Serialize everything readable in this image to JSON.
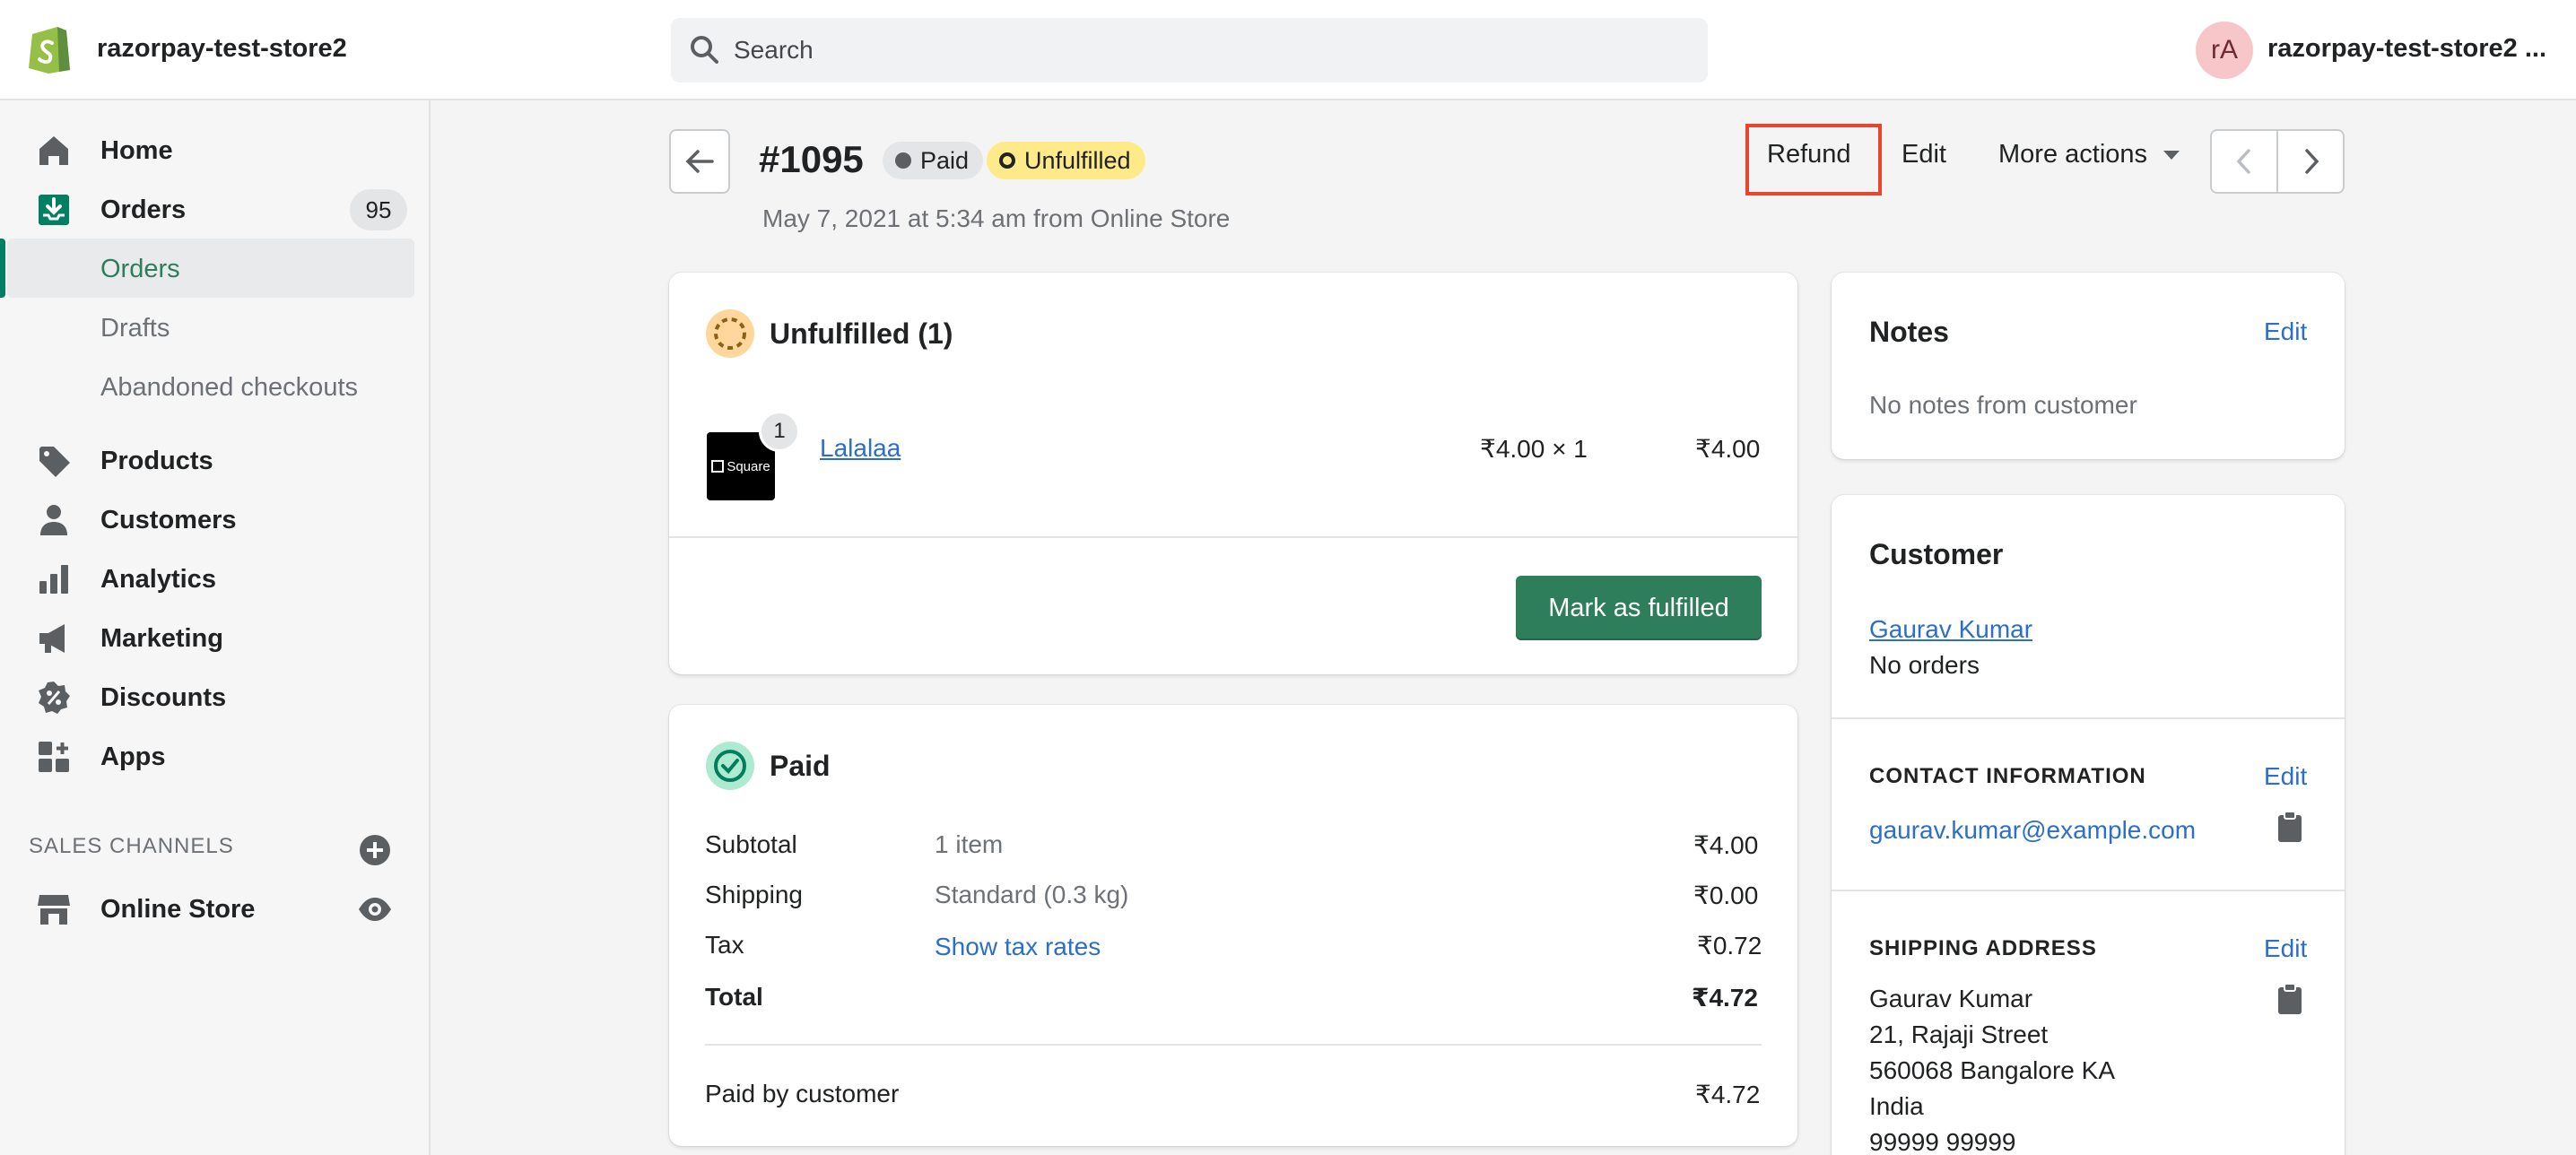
{
  "topbar": {
    "store_name": "razorpay-test-store2",
    "search_placeholder": "Search",
    "avatar_initials": "rA",
    "account_name": "razorpay-test-store2 ..."
  },
  "sidebar": {
    "items": [
      {
        "label": "Home",
        "icon": "home-icon"
      },
      {
        "label": "Orders",
        "icon": "orders-icon",
        "badge": "95"
      },
      {
        "label": "Orders",
        "sub": true,
        "active": true
      },
      {
        "label": "Drafts",
        "sub": true
      },
      {
        "label": "Abandoned checkouts",
        "sub": true
      },
      {
        "label": "Products",
        "icon": "tag-icon"
      },
      {
        "label": "Customers",
        "icon": "person-icon"
      },
      {
        "label": "Analytics",
        "icon": "bar-chart-icon"
      },
      {
        "label": "Marketing",
        "icon": "megaphone-icon"
      },
      {
        "label": "Discounts",
        "icon": "discount-icon"
      },
      {
        "label": "Apps",
        "icon": "apps-icon"
      }
    ],
    "sales_channels_title": "SALES CHANNELS",
    "online_store": "Online Store"
  },
  "header": {
    "order_number": "#1095",
    "payment_status": "Paid",
    "fulfillment_status": "Unfulfilled",
    "subtitle": "May 7, 2021 at 5:34 am from Online Store",
    "refund_label": "Refund",
    "edit_label": "Edit",
    "more_actions_label": "More actions"
  },
  "unfulfilled": {
    "title": "Unfulfilled (1)",
    "item_name": "Lalalaa",
    "item_quantity": "1",
    "thumb_text": "Square",
    "unit_price": "₹4.00 × 1",
    "line_total": "₹4.00",
    "fulfill_button": "Mark as fulfilled"
  },
  "paid": {
    "title": "Paid",
    "rows": [
      {
        "label": "Subtotal",
        "detail": "1 item",
        "amount": "₹4.00"
      },
      {
        "label": "Shipping",
        "detail": "Standard (0.3 kg)",
        "amount": "₹0.00"
      },
      {
        "label": "Tax",
        "detail": "Show tax rates",
        "amount": "₹0.72"
      },
      {
        "label": "Total",
        "detail": "",
        "amount": "₹4.72"
      }
    ],
    "paid_by_label": "Paid by customer",
    "paid_by_amount": "₹4.72"
  },
  "notes": {
    "title": "Notes",
    "edit_label": "Edit",
    "text": "No notes from customer"
  },
  "customer": {
    "title": "Customer",
    "name": "Gaurav Kumar",
    "orders": "No orders",
    "contact_title": "CONTACT INFORMATION",
    "contact_edit": "Edit",
    "email": "gaurav.kumar@example.com",
    "shipping_title": "SHIPPING ADDRESS",
    "shipping_edit": "Edit",
    "address_lines": [
      "Gaurav Kumar",
      "21, Rajaji Street",
      "560068 Bangalore KA",
      "India",
      "99999 99999"
    ]
  },
  "colors": {
    "brand_green": "#008060",
    "primary_button": "#2e7d5b",
    "link_blue": "#2c6ecb",
    "highlight_red": "#e8462e",
    "unfulfilled_yellow": "#ffea8a"
  }
}
